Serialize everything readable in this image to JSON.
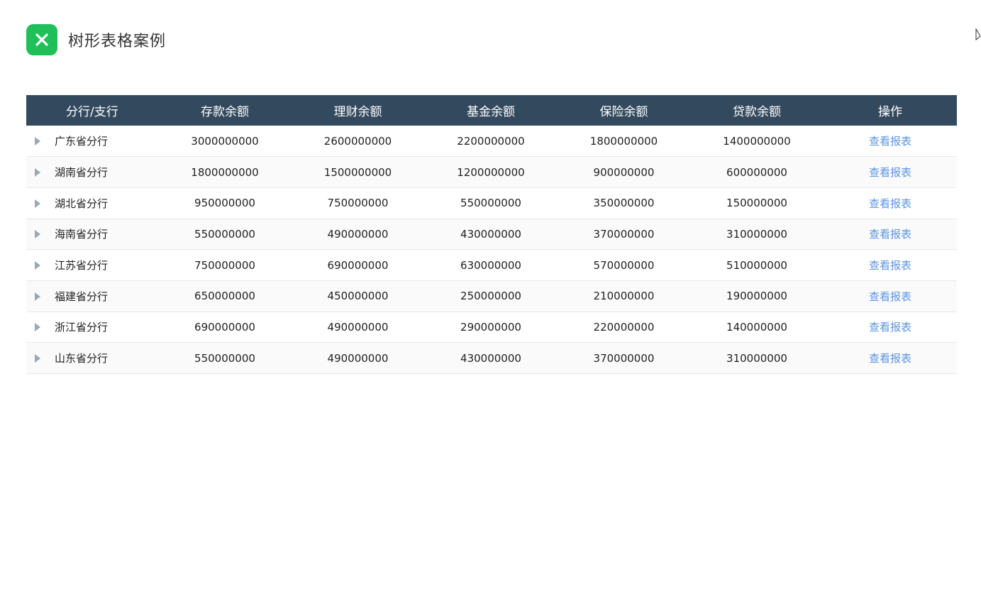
{
  "app": {
    "title": "树形表格案例",
    "logo_icon": "close-x-icon",
    "logo_color": "#1fbf5a"
  },
  "table": {
    "header_color": "#334a5e",
    "columns": [
      "分行/支行",
      "存款余额",
      "理财余额",
      "基金余额",
      "保险余额",
      "贷款余额",
      "操作"
    ],
    "action_label": "查看报表",
    "rows": [
      {
        "name": "广东省分行",
        "deposit": "3000000000",
        "wealth": "2600000000",
        "fund": "2200000000",
        "insurance": "1800000000",
        "loan": "1400000000"
      },
      {
        "name": "湖南省分行",
        "deposit": "1800000000",
        "wealth": "1500000000",
        "fund": "1200000000",
        "insurance": "900000000",
        "loan": "600000000"
      },
      {
        "name": "湖北省分行",
        "deposit": "950000000",
        "wealth": "750000000",
        "fund": "550000000",
        "insurance": "350000000",
        "loan": "150000000"
      },
      {
        "name": "海南省分行",
        "deposit": "550000000",
        "wealth": "490000000",
        "fund": "430000000",
        "insurance": "370000000",
        "loan": "310000000"
      },
      {
        "name": "江苏省分行",
        "deposit": "750000000",
        "wealth": "690000000",
        "fund": "630000000",
        "insurance": "570000000",
        "loan": "510000000"
      },
      {
        "name": "福建省分行",
        "deposit": "650000000",
        "wealth": "450000000",
        "fund": "250000000",
        "insurance": "210000000",
        "loan": "190000000"
      },
      {
        "name": "浙江省分行",
        "deposit": "690000000",
        "wealth": "490000000",
        "fund": "290000000",
        "insurance": "220000000",
        "loan": "140000000"
      },
      {
        "name": "山东省分行",
        "deposit": "550000000",
        "wealth": "490000000",
        "fund": "430000000",
        "insurance": "370000000",
        "loan": "310000000"
      }
    ]
  }
}
